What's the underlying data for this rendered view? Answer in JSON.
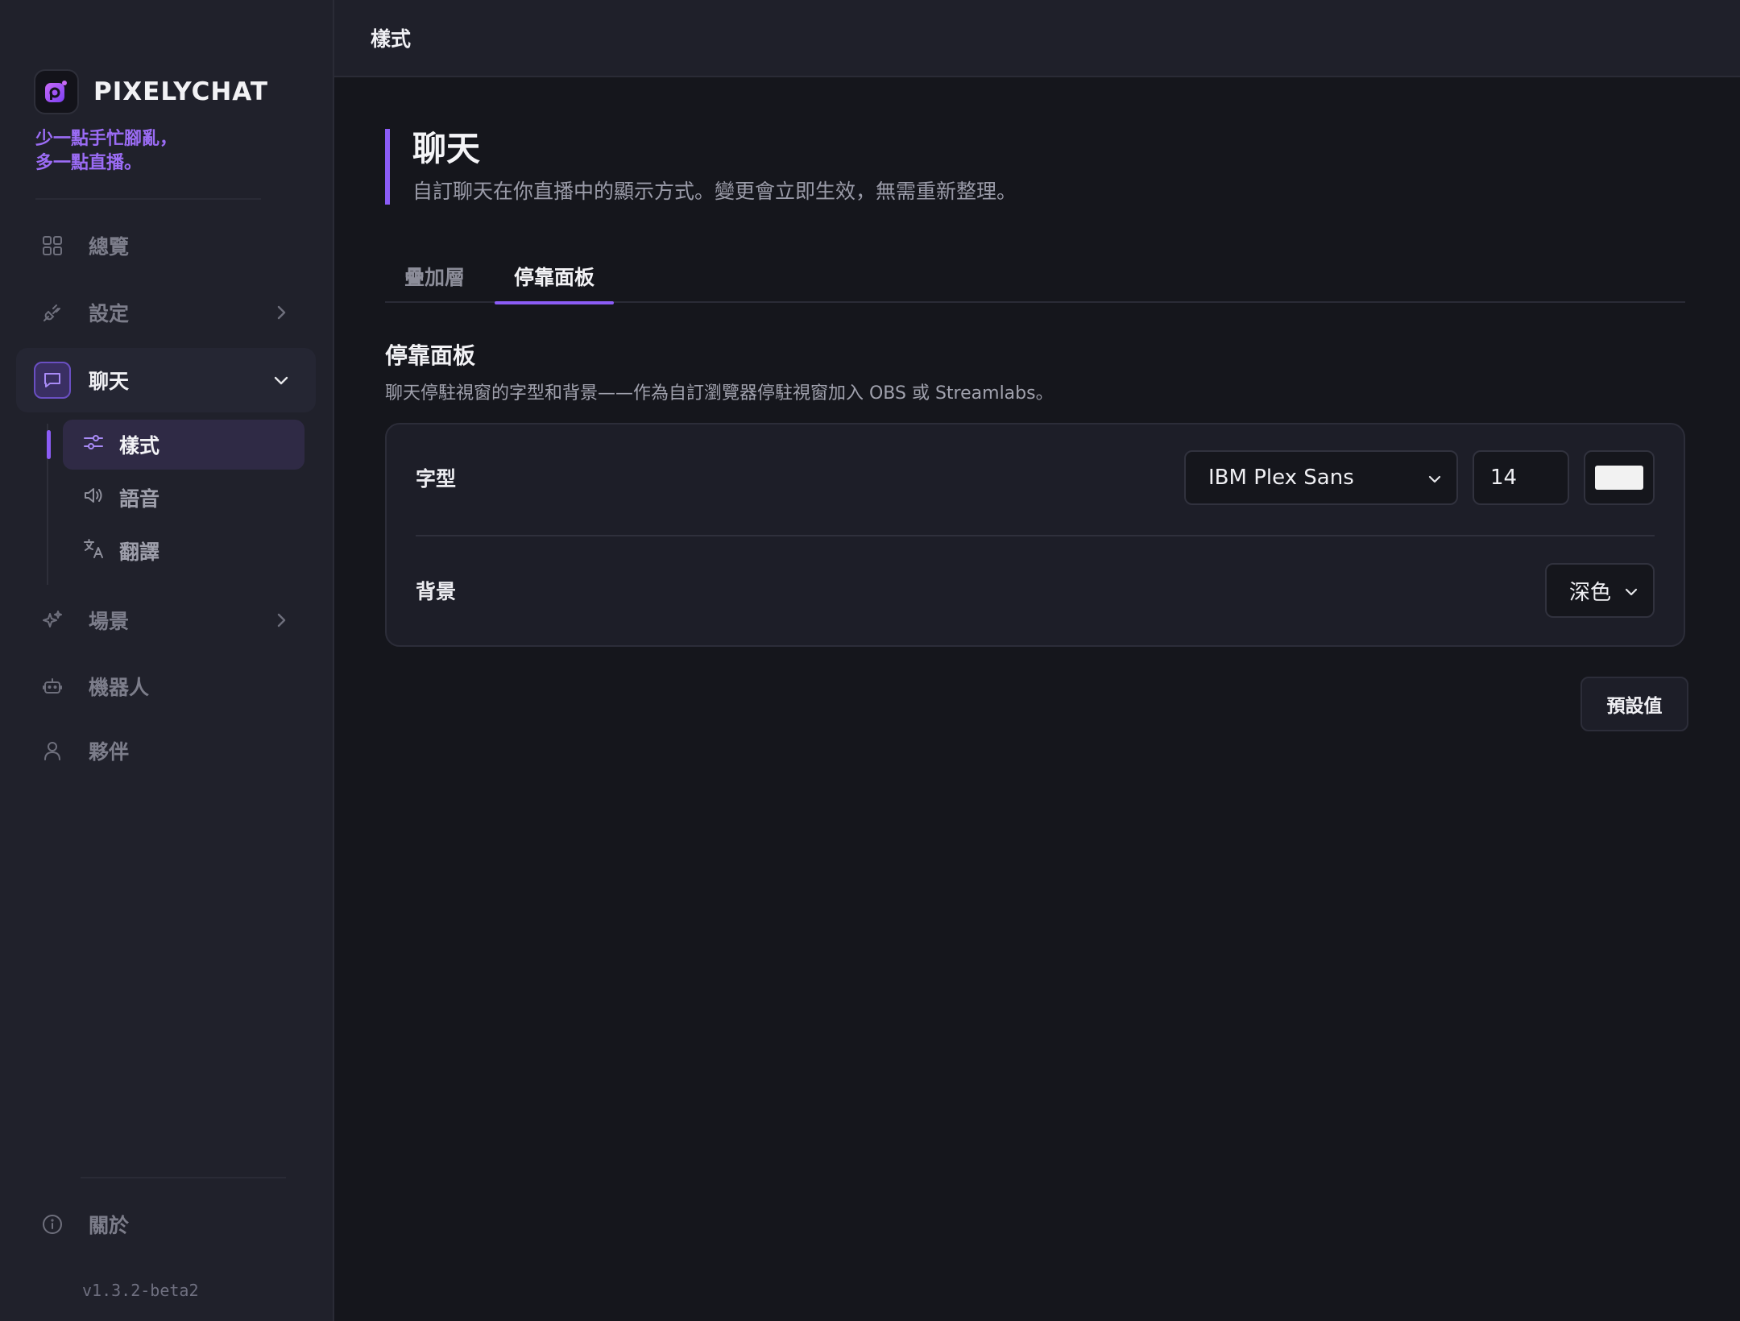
{
  "brand": {
    "name": "PIXELYCHAT",
    "tagline_line1": "少一點手忙腳亂，",
    "tagline_line2": "多一點直播。"
  },
  "sidebar": {
    "items": [
      {
        "label": "總覽",
        "icon": "grid-icon"
      },
      {
        "label": "設定",
        "icon": "plug-icon"
      },
      {
        "label": "聊天",
        "icon": "chat-bubble-icon"
      },
      {
        "label": "場景",
        "icon": "sparkles-icon"
      },
      {
        "label": "機器人",
        "icon": "robot-icon"
      },
      {
        "label": "夥伴",
        "icon": "user-icon"
      }
    ],
    "chat_subitems": [
      {
        "label": "樣式",
        "icon": "sliders-icon"
      },
      {
        "label": "語音",
        "icon": "speaker-icon"
      },
      {
        "label": "翻譯",
        "icon": "translate-icon"
      }
    ],
    "about": "關於",
    "version": "v1.3.2-beta2"
  },
  "topbar": {
    "title": "樣式"
  },
  "header": {
    "title": "聊天",
    "description": "自訂聊天在你直播中的顯示方式。變更會立即生效，無需重新整理。"
  },
  "tabs": [
    {
      "label": "疊加層"
    },
    {
      "label": "停靠面板"
    }
  ],
  "section": {
    "title": "停靠面板",
    "description": "聊天停駐視窗的字型和背景——作為自訂瀏覽器停駐視窗加入 OBS 或 Streamlabs。"
  },
  "font_row": {
    "label": "字型",
    "font_value": "IBM Plex Sans",
    "size_value": "14",
    "color_value": "#f2f2f2"
  },
  "background_row": {
    "label": "背景",
    "value": "深色"
  },
  "reset_button": {
    "label": "預設值"
  },
  "colors": {
    "accent": "#8b5cf6",
    "bg": "#15161c",
    "sidebar": "#20212b"
  }
}
